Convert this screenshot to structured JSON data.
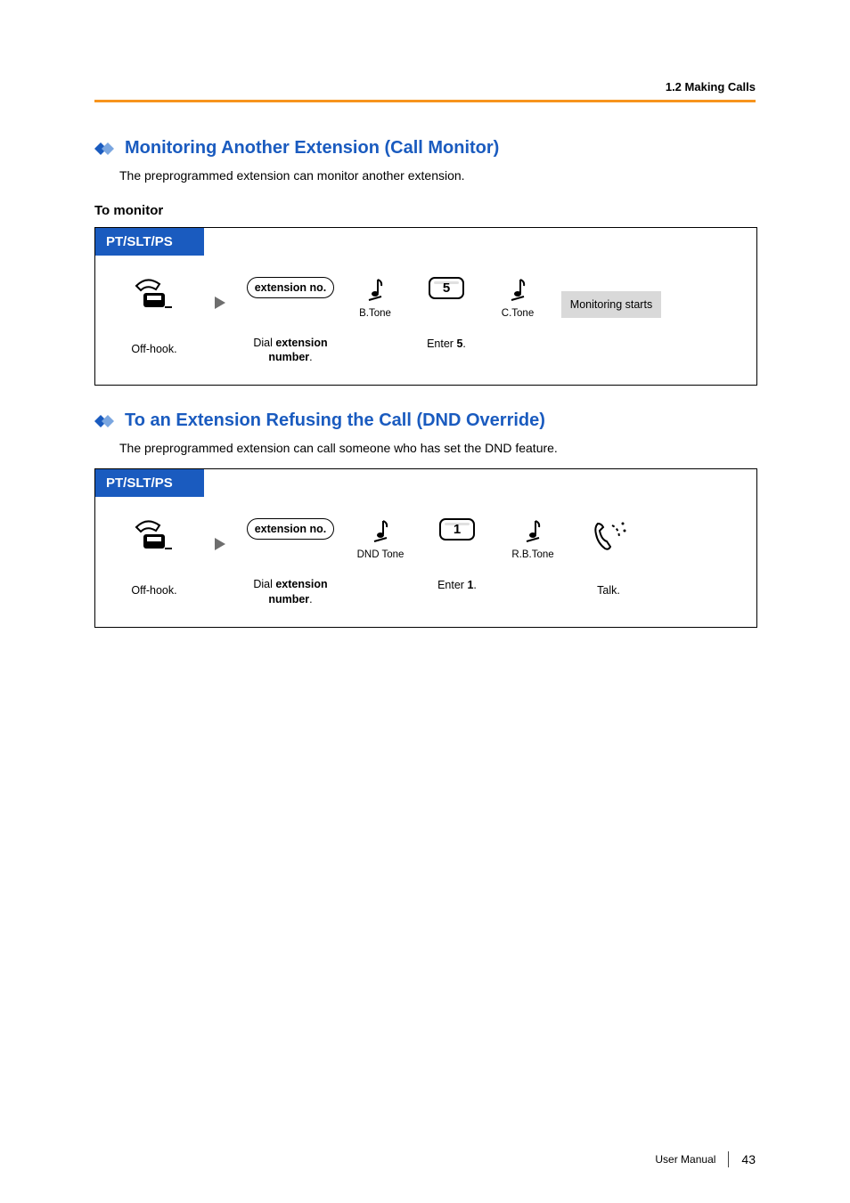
{
  "header": {
    "breadcrumb": "1.2 Making Calls"
  },
  "section1": {
    "title": "Monitoring Another Extension (Call Monitor)",
    "intro": "The preprogrammed extension can monitor another extension.",
    "subhead": "To monitor",
    "tab": "PT/SLT/PS",
    "steps": {
      "offhook_label": "Off-hook.",
      "ext_box": "extension no.",
      "dial_label_pre": "Dial ",
      "dial_label_bold": "extension number",
      "dial_label_post": ".",
      "btone": "B.Tone",
      "key": "5",
      "enter_pre": "Enter ",
      "enter_bold": "5",
      "enter_post": ".",
      "ctone": "C.Tone",
      "result": "Monitoring starts"
    }
  },
  "section2": {
    "title": "To an Extension Refusing the Call (DND Override)",
    "intro": "The preprogrammed extension can call someone who has set the DND feature.",
    "tab": "PT/SLT/PS",
    "steps": {
      "offhook_label": "Off-hook.",
      "ext_box": "extension no.",
      "dial_label_pre": "Dial ",
      "dial_label_bold": "extension number",
      "dial_label_post": ".",
      "dndtone": "DND Tone",
      "key": "1",
      "enter_pre": "Enter ",
      "enter_bold": "1",
      "enter_post": ".",
      "rbtone": "R.B.Tone",
      "talk": "Talk."
    }
  },
  "footer": {
    "manual": "User Manual",
    "page": "43"
  }
}
